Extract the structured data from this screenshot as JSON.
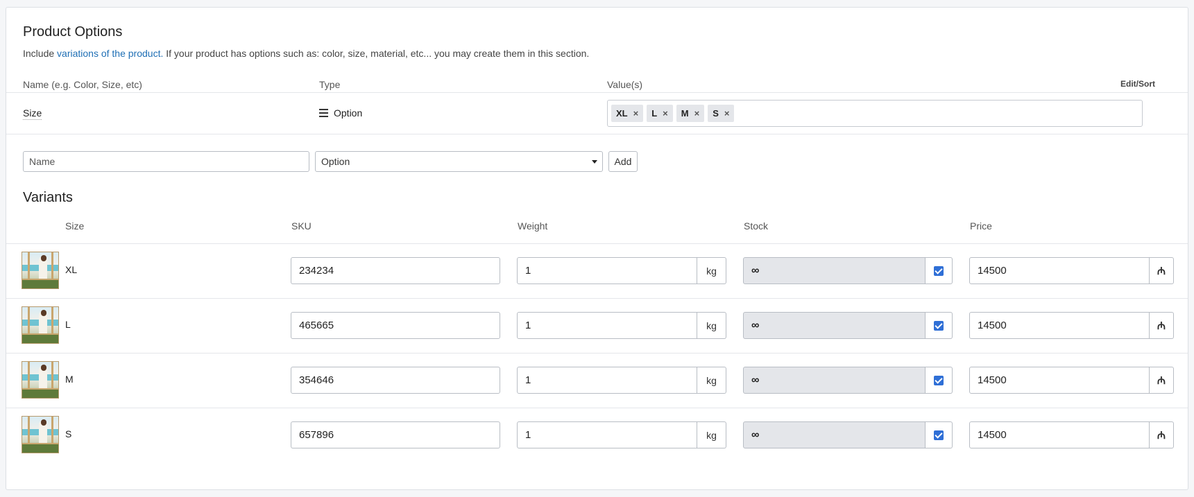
{
  "options": {
    "title": "Product Options",
    "desc_prefix": "Include ",
    "desc_link": "variations of the product.",
    "desc_suffix": " If your product has options such as: color, size, material, etc... you may create them in this section.",
    "col_name": "Name (e.g. Color, Size, etc)",
    "col_type": "Type",
    "col_values": "Value(s)",
    "edit_sort": "Edit/Sort",
    "row": {
      "name": "Size",
      "type": "Option",
      "values": [
        "XL",
        "L",
        "M",
        "S"
      ]
    },
    "new": {
      "name_placeholder": "Name",
      "type_value": "Option",
      "add_label": "Add"
    }
  },
  "variants": {
    "title": "Variants",
    "col_size": "Size",
    "col_sku": "SKU",
    "col_weight": "Weight",
    "col_stock": "Stock",
    "col_price": "Price",
    "rows": [
      {
        "size": "XL",
        "sku": "234234",
        "weight": "1",
        "unit": "kg",
        "stock": "∞",
        "unlimited": true,
        "price": "14500",
        "currency": "₼"
      },
      {
        "size": "L",
        "sku": "465665",
        "weight": "1",
        "unit": "kg",
        "stock": "∞",
        "unlimited": true,
        "price": "14500",
        "currency": "₼"
      },
      {
        "size": "M",
        "sku": "354646",
        "weight": "1",
        "unit": "kg",
        "stock": "∞",
        "unlimited": true,
        "price": "14500",
        "currency": "₼"
      },
      {
        "size": "S",
        "sku": "657896",
        "weight": "1",
        "unit": "kg",
        "stock": "∞",
        "unlimited": true,
        "price": "14500",
        "currency": "₼"
      }
    ]
  },
  "colors": {
    "link": "#1f6fb5",
    "checkbox": "#2f6fd6",
    "stock_bg": "#e4e6ea"
  },
  "icons": {
    "type": "list-icon",
    "remove": "close-icon",
    "caret": "chevron-down-icon",
    "thumbnail": "product-image"
  }
}
